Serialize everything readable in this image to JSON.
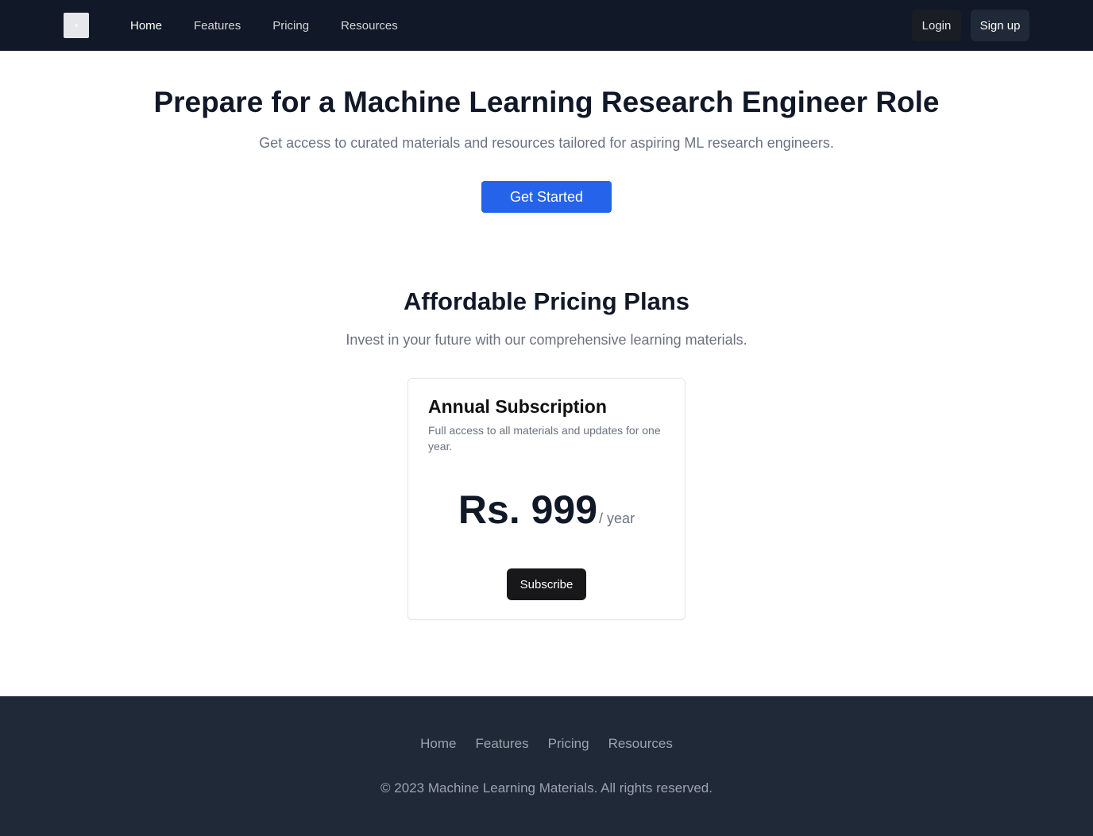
{
  "nav": {
    "items": [
      {
        "label": "Home",
        "active": true
      },
      {
        "label": "Features",
        "active": false
      },
      {
        "label": "Pricing",
        "active": false
      },
      {
        "label": "Resources",
        "active": false
      }
    ],
    "login_label": "Login",
    "signup_label": "Sign up"
  },
  "hero": {
    "title": "Prepare for a Machine Learning Research Engineer Role",
    "subtitle": "Get access to curated materials and resources tailored for aspiring ML research engineers.",
    "cta_label": "Get Started"
  },
  "pricing": {
    "title": "Affordable Pricing Plans",
    "subtitle": "Invest in your future with our comprehensive learning materials.",
    "plan": {
      "name": "Annual Subscription",
      "description": "Full access to all materials and updates for one year.",
      "price": "Rs. 999",
      "period": "/ year",
      "button_label": "Subscribe"
    }
  },
  "footer": {
    "links": [
      "Home",
      "Features",
      "Pricing",
      "Resources"
    ],
    "copyright": "© 2023 Machine Learning Materials. All rights reserved."
  },
  "colors": {
    "nav_bg": "#111827",
    "footer_bg": "#1f2937",
    "primary": "#2563eb",
    "dark_button": "#18181b"
  },
  "icons": {
    "logo": "logo-placeholder-icon"
  }
}
